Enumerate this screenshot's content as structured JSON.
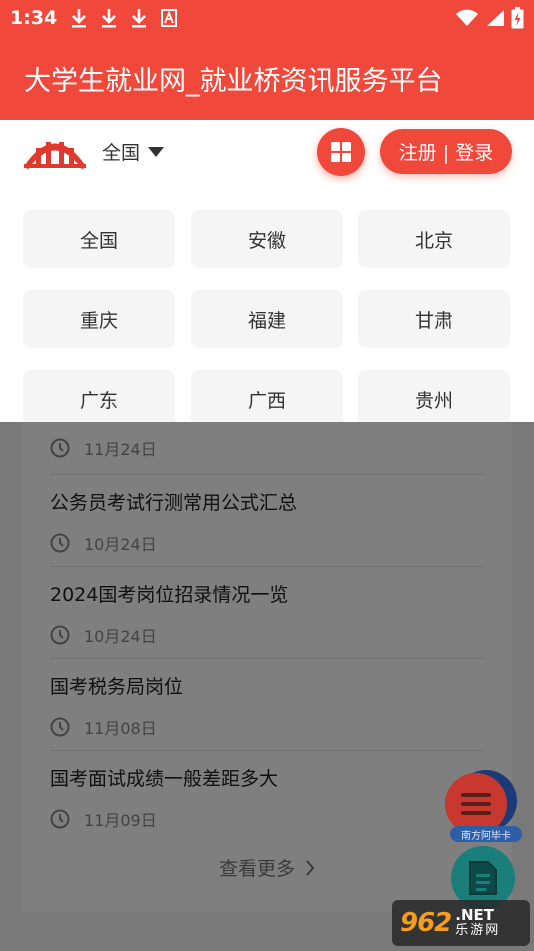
{
  "status_bar": {
    "time": "1:34"
  },
  "title_bar": {
    "title": "大学生就业网_就业桥资讯服务平台"
  },
  "header": {
    "region_selected": "全国",
    "login_label": "注册 | 登录"
  },
  "regions": [
    "全国",
    "安徽",
    "北京",
    "重庆",
    "福建",
    "甘肃",
    "广东",
    "广西",
    "贵州"
  ],
  "news": [
    {
      "title": "",
      "date": "11月24日"
    },
    {
      "title": "公务员考试行测常用公式汇总",
      "date": "10月24日"
    },
    {
      "title": "2024国考岗位招录情况一览",
      "date": "10月24日"
    },
    {
      "title": "国考税务局岗位",
      "date": "11月08日"
    },
    {
      "title": "国考面试成绩一般差距多大",
      "date": "11月09日"
    }
  ],
  "more_label": "查看更多",
  "fab": {
    "card_label": "南方阿毕卡"
  },
  "watermark": {
    "number": "962",
    "net": ".NET",
    "site": "乐游网"
  },
  "colors": {
    "brand": "#f0483a",
    "overlay": "rgba(0,0,0,0.5)"
  }
}
